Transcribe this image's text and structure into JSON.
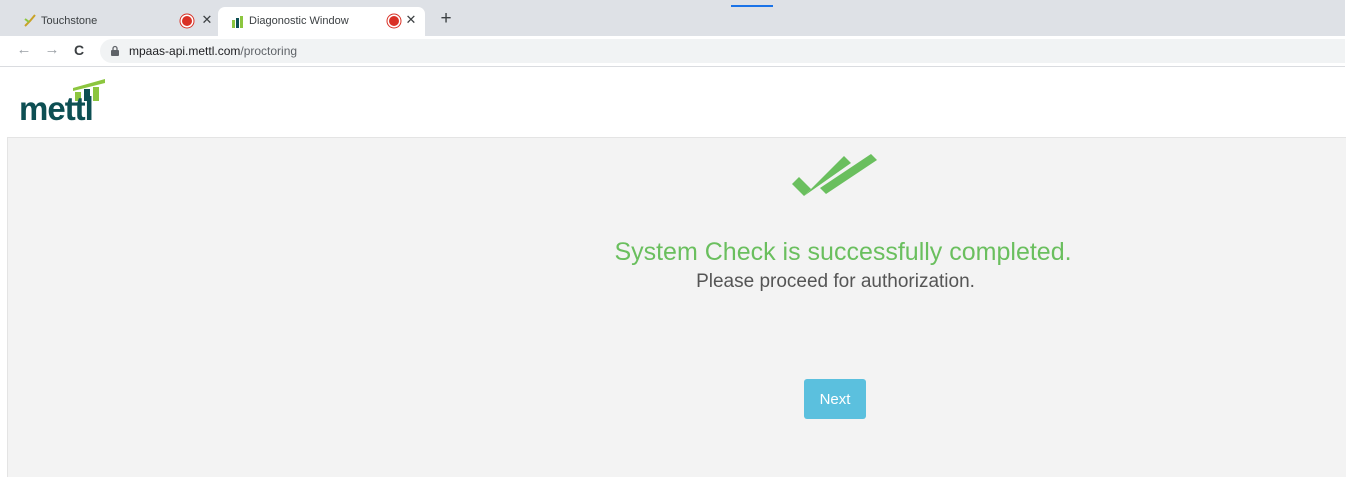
{
  "browser": {
    "tabs": [
      {
        "title": "Touchstone",
        "active": false,
        "recording": true
      },
      {
        "title": "Diagonostic Window",
        "active": true,
        "recording": true
      }
    ],
    "close_glyph": "✕",
    "new_tab_glyph": "+",
    "nav": {
      "back": "←",
      "forward": "→",
      "reload": "C"
    },
    "url": {
      "host": "mpaas-api.mettl.com",
      "path": "/proctoring"
    }
  },
  "header": {
    "logo_text": "mettl",
    "logo_colors": {
      "text": "#0d4f53",
      "bars_light": "#8cc63f",
      "bars_dark": "#0d4f53"
    }
  },
  "main": {
    "title": "System Check is successfully completed.",
    "subtitle": "Please proceed for authorization.",
    "next_button": "Next",
    "colors": {
      "success": "#6abf5e",
      "button": "#5bc0de",
      "panel": "#f3f3f3"
    }
  }
}
